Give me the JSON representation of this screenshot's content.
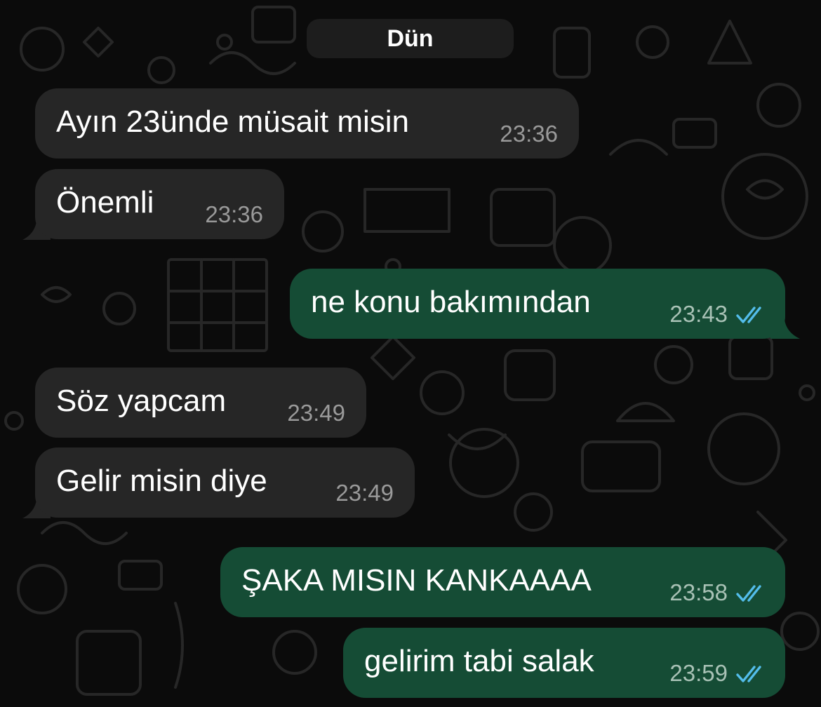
{
  "theme": {
    "incoming_bubble": "#262626",
    "outgoing_bubble": "#154c35",
    "read_ticks": "#53bdeb",
    "background": "#0b0b0b"
  },
  "chat": {
    "date_label": "Dün",
    "messages": [
      {
        "direction": "incoming",
        "text": "Ayın 23ünde müsait misin",
        "time": "23:36"
      },
      {
        "direction": "incoming",
        "text": "Önemli",
        "time": "23:36"
      },
      {
        "direction": "outgoing",
        "text": "ne konu bakımından",
        "time": "23:43",
        "status_icon": "double-check-read-icon"
      },
      {
        "direction": "incoming",
        "text": "Söz yapcam",
        "time": "23:49"
      },
      {
        "direction": "incoming",
        "text": "Gelir misin diye",
        "time": "23:49"
      },
      {
        "direction": "outgoing",
        "text": "ŞAKA MISIN KANKAAAA",
        "time": "23:58",
        "status_icon": "double-check-read-icon"
      },
      {
        "direction": "outgoing",
        "text": "gelirim tabi salak",
        "time": "23:59",
        "status_icon": "double-check-read-icon"
      }
    ]
  }
}
